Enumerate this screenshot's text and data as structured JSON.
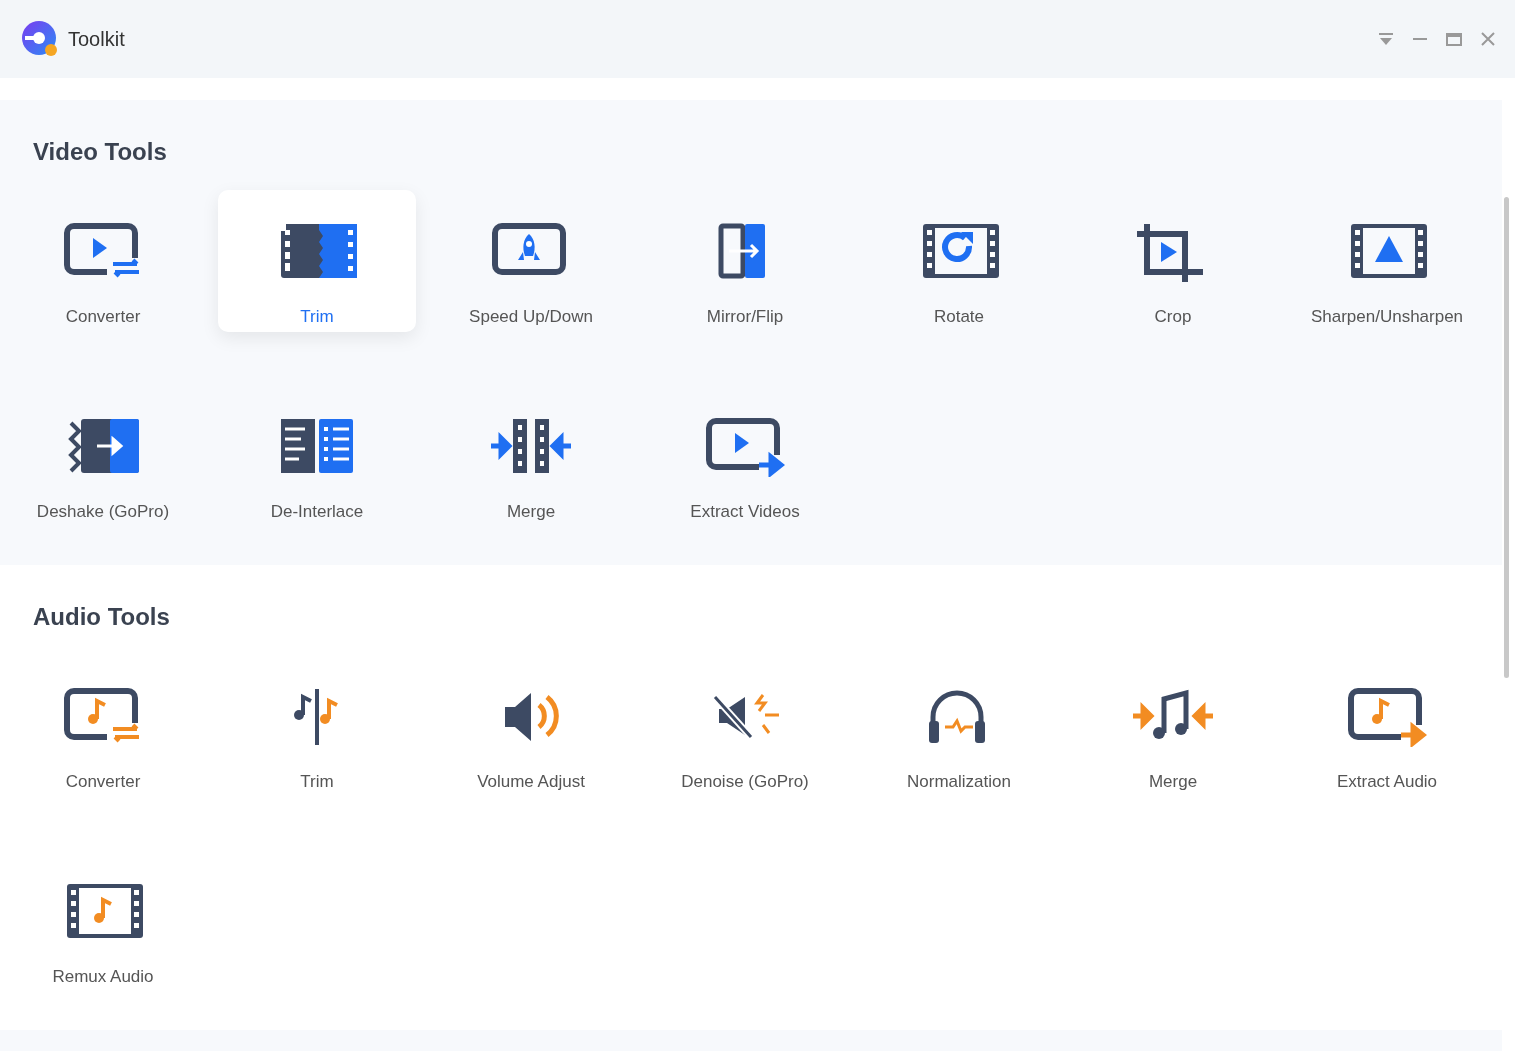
{
  "window": {
    "title": "Toolkit"
  },
  "sections": [
    {
      "title": "Video Tools",
      "tools": [
        {
          "label": "Converter",
          "selected": false
        },
        {
          "label": "Trim",
          "selected": true
        },
        {
          "label": "Speed Up/Down",
          "selected": false
        },
        {
          "label": "Mirror/Flip",
          "selected": false
        },
        {
          "label": "Rotate",
          "selected": false
        },
        {
          "label": "Crop",
          "selected": false
        },
        {
          "label": "Sharpen/Unsharpen",
          "selected": false
        },
        {
          "label": "Deshake (GoPro)",
          "selected": false
        },
        {
          "label": "De-Interlace",
          "selected": false
        },
        {
          "label": "Merge",
          "selected": false
        },
        {
          "label": "Extract Videos",
          "selected": false
        }
      ]
    },
    {
      "title": "Audio Tools",
      "tools": [
        {
          "label": "Converter",
          "selected": false
        },
        {
          "label": "Trim",
          "selected": false
        },
        {
          "label": "Volume Adjust",
          "selected": false
        },
        {
          "label": "Denoise (GoPro)",
          "selected": false
        },
        {
          "label": "Normalization",
          "selected": false
        },
        {
          "label": "Merge",
          "selected": false
        },
        {
          "label": "Extract Audio",
          "selected": false
        },
        {
          "label": "Remux Audio",
          "selected": false
        }
      ]
    }
  ]
}
